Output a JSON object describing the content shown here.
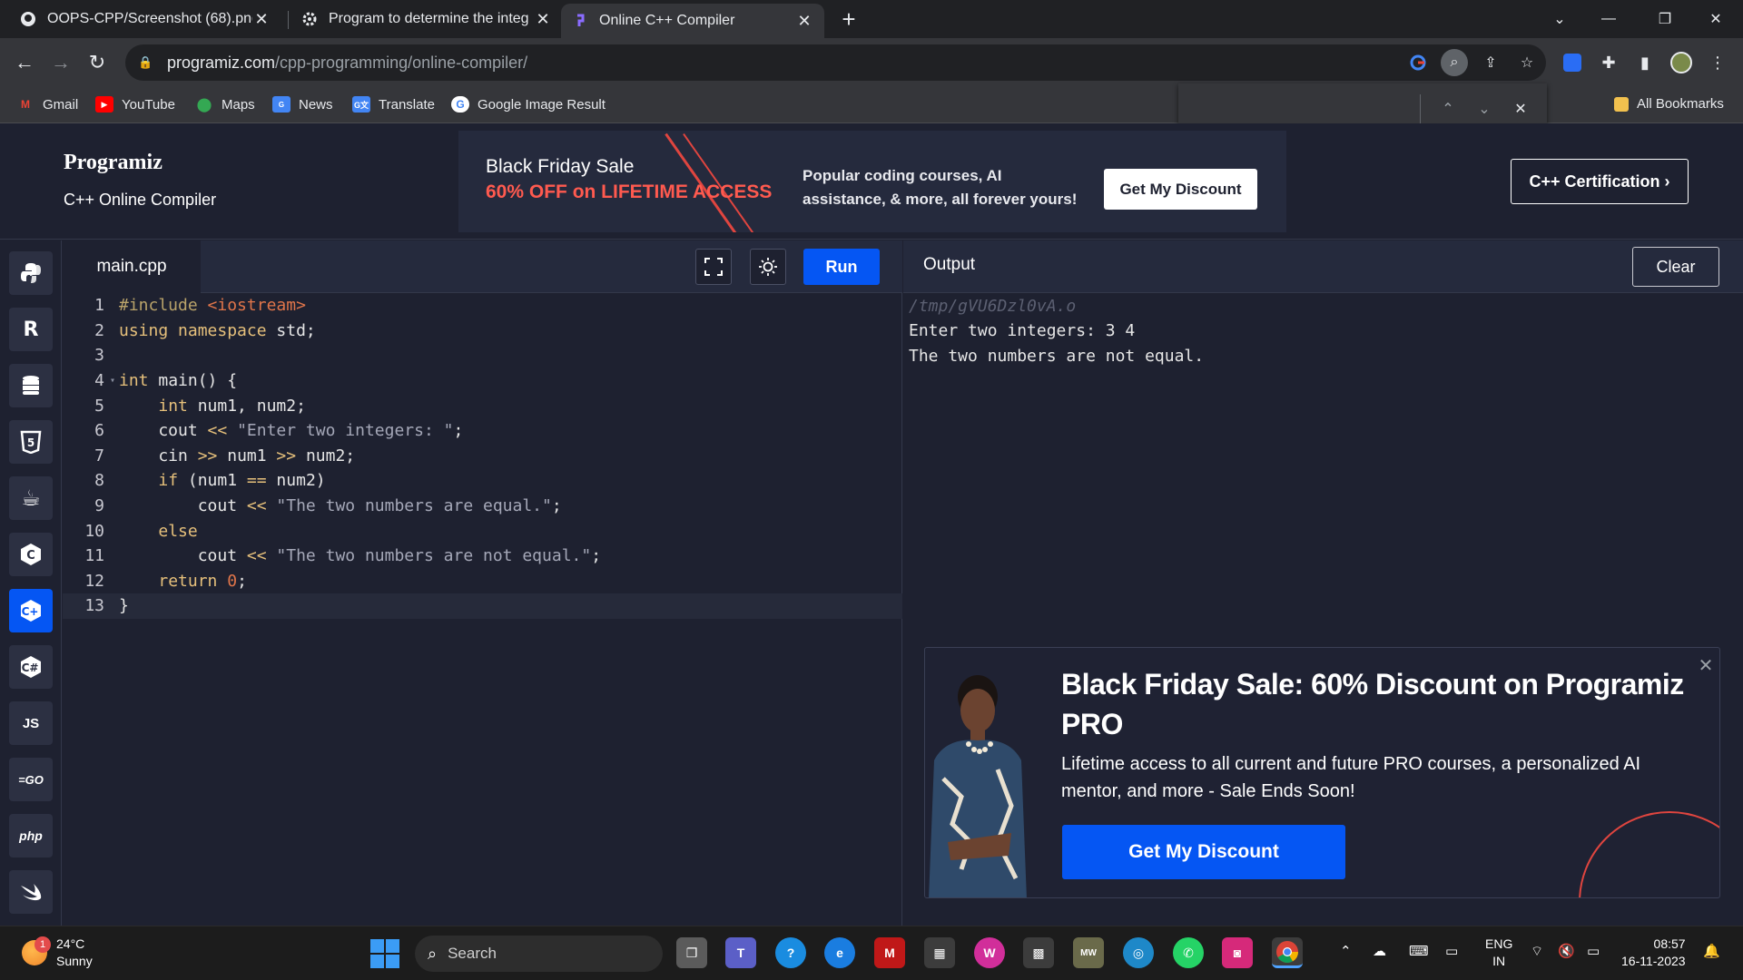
{
  "browser": {
    "tabs": [
      {
        "title": "OOPS-CPP/Screenshot (68).png",
        "icon": "github-icon"
      },
      {
        "title": "Program to determine the integ",
        "icon": "gear-icon"
      },
      {
        "title": "Online C++ Compiler",
        "icon": "programiz-icon"
      }
    ],
    "url_host": "programiz.com",
    "url_path": "/cpp-programming/online-compiler/",
    "bookmarks": [
      {
        "label": "Gmail",
        "icon": "gmail-icon",
        "color": "#ea4335"
      },
      {
        "label": "YouTube",
        "icon": "youtube-icon",
        "color": "#ff0000"
      },
      {
        "label": "Maps",
        "icon": "maps-icon",
        "color": "#34a853"
      },
      {
        "label": "News",
        "icon": "news-icon",
        "color": "#4285f4"
      },
      {
        "label": "Translate",
        "icon": "translate-icon",
        "color": "#4285f4"
      },
      {
        "label": "Google Image Result",
        "icon": "google-icon",
        "color": "#ffffff"
      }
    ],
    "all_bookmarks": "All Bookmarks"
  },
  "site": {
    "logo": "Programiz",
    "subtitle": "C++ Online Compiler",
    "banner": {
      "title": "Black Friday Sale",
      "subtitle": "60% OFF on LIFETIME ACCESS",
      "desc_line1": "Popular coding courses, AI",
      "desc_line2": "assistance, & more, all forever yours!",
      "button": "Get My Discount"
    },
    "cert_button": "C++ Certification ›"
  },
  "languages": [
    {
      "name": "python",
      "label": "Py"
    },
    {
      "name": "r",
      "label": "R"
    },
    {
      "name": "sql",
      "label": "≡"
    },
    {
      "name": "html",
      "label": "5"
    },
    {
      "name": "java",
      "label": "♨"
    },
    {
      "name": "c",
      "label": "C"
    },
    {
      "name": "cpp",
      "label": "C+"
    },
    {
      "name": "csharp",
      "label": "C#"
    },
    {
      "name": "javascript",
      "label": "JS"
    },
    {
      "name": "go",
      "label": "GO"
    },
    {
      "name": "php",
      "label": "php"
    },
    {
      "name": "swift",
      "label": "➤"
    }
  ],
  "editor": {
    "filename": "main.cpp",
    "run": "Run",
    "lines": [
      "#include <iostream>",
      "using namespace std;",
      "",
      "int main() {",
      "    int num1, num2;",
      "    cout << \"Enter two integers: \";",
      "    cin >> num1 >> num2;",
      "    if (num1 == num2)",
      "        cout << \"The two numbers are equal.\";",
      "    else",
      "        cout << \"The two numbers are not equal.\";",
      "    return 0;",
      "}"
    ]
  },
  "output": {
    "title": "Output",
    "clear": "Clear",
    "lines": [
      "/tmp/gVU6Dzl0vA.o",
      "Enter two integers: 3 4",
      "The two numbers are not equal."
    ]
  },
  "promo": {
    "title": "Black Friday Sale: 60% Discount on Programiz PRO",
    "desc": "Lifetime access to all current and future PRO courses, a personalized AI mentor, and more - Sale Ends Soon!",
    "button": "Get My Discount"
  },
  "taskbar": {
    "temp": "24°C",
    "condition": "Sunny",
    "weather_badge": "1",
    "search": "Search",
    "lang": "ENG",
    "region": "IN",
    "time": "08:57",
    "date": "16-11-2023"
  }
}
